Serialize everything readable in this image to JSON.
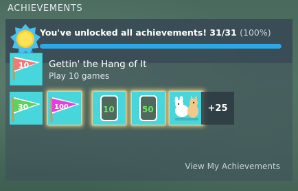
{
  "section": {
    "title": "ACHIEVEMENTS"
  },
  "summary": {
    "text": "You've unlocked all achievements! 31/31",
    "percent_text": "(100%)",
    "unlocked": 31,
    "total": 31,
    "progress_fraction": 1.0
  },
  "latest_achievement": {
    "name": "Gettin' the Hang of It",
    "description": "Play 10 games",
    "icon": "flag-10-icon"
  },
  "achievement_icons": [
    {
      "icon": "flag-30-icon",
      "label": "30"
    },
    {
      "icon": "flag-100-icon",
      "label": "100"
    },
    {
      "icon": "card-10-icon",
      "label": "10"
    },
    {
      "icon": "card-50-icon",
      "label": "50"
    },
    {
      "icon": "animals-icon"
    }
  ],
  "more_count_label": "+25",
  "view_link": "View My Achievements",
  "colors": {
    "accent": "#2ea7e6",
    "icon_bg": "#3fd2d9"
  }
}
